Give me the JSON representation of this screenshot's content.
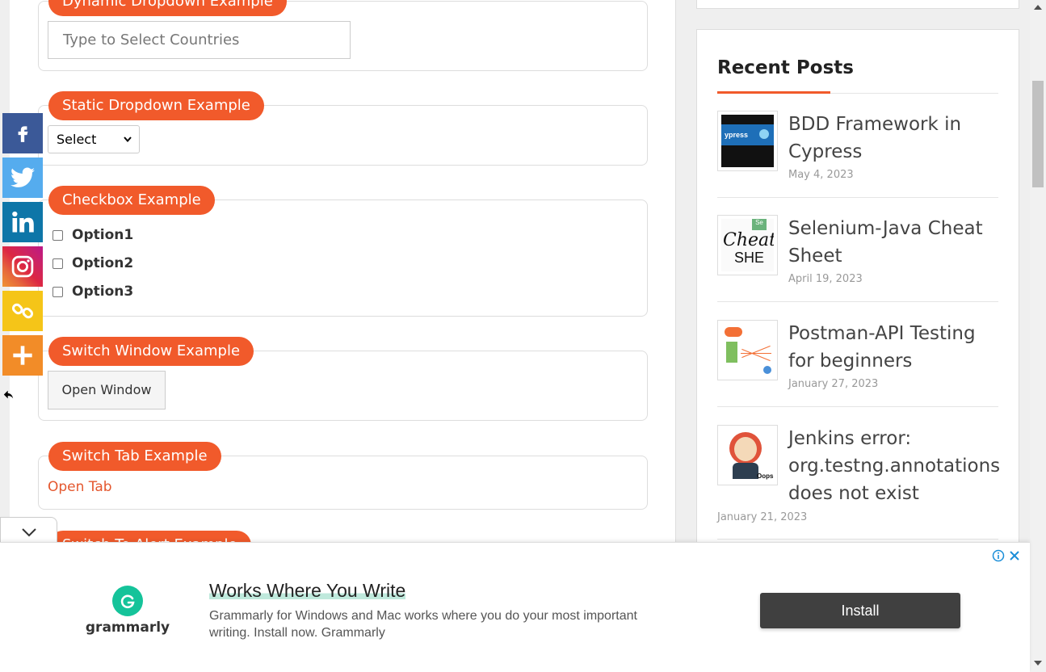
{
  "main": {
    "dynamic_dropdown": {
      "legend": "Dynamic Dropdown Example",
      "input_placeholder": "Type to Select Countries"
    },
    "static_dropdown": {
      "legend": "Static Dropdown Example",
      "selected": "Select"
    },
    "checkbox": {
      "legend": "Checkbox Example",
      "options": [
        "Option1",
        "Option2",
        "Option3"
      ]
    },
    "switch_window": {
      "legend": "Switch Window Example",
      "button_label": "Open Window"
    },
    "switch_tab": {
      "legend": "Switch Tab Example",
      "link_label": "Open Tab"
    },
    "switch_alert": {
      "legend": "Switch To Alert Example"
    }
  },
  "share_bar": {
    "icons": [
      "facebook-icon",
      "twitter-icon",
      "linkedin-icon",
      "instagram-icon",
      "copy-link-icon",
      "more-icon"
    ],
    "colors": [
      "#3b5998",
      "#55acee",
      "#0e76a8",
      "#d6249f",
      "#f5c518",
      "#f28c28"
    ]
  },
  "sidebar": {
    "recent_posts_title": "Recent Posts",
    "posts": [
      {
        "title": "BDD Framework in Cypress",
        "date": "May 4, 2023"
      },
      {
        "title": "Selenium-Java Cheat Sheet",
        "date": "April 19, 2023"
      },
      {
        "title": "Postman-API Testing for beginners",
        "date": "January 27, 2023"
      },
      {
        "title": "Jenkins error: org.testng.annotations does not exist",
        "date": "January 21, 2023"
      }
    ]
  },
  "ad": {
    "brand": "grammarly",
    "headline": "Works Where You Write",
    "body": "Grammarly for Windows and Mac works where you do your most important writing. Install now. Grammarly",
    "cta": "Install",
    "accent": "#15c39a"
  },
  "colors": {
    "accent": "#f15a2b",
    "link": "#e4572e"
  }
}
